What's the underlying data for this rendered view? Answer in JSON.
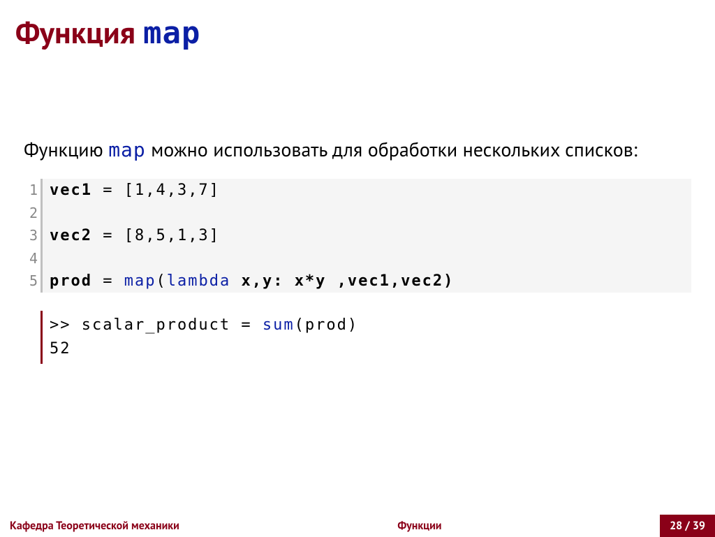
{
  "title": {
    "prefix": "Функция ",
    "code": "map"
  },
  "para": {
    "p1": "Функцию ",
    "code": "map",
    "p2": " можно использовать для обработки нескольких списков:"
  },
  "code": {
    "lines": [
      {
        "n": "1",
        "kw": "vec1",
        "rest": " = [1,4,3,7]"
      },
      {
        "n": "2",
        "kw": "",
        "rest": ""
      },
      {
        "n": "3",
        "kw": "vec2",
        "rest": " = [8,5,1,3]"
      },
      {
        "n": "4",
        "kw": "",
        "rest": ""
      },
      {
        "n": "5",
        "kw": "prod",
        "rest_pre": " = ",
        "fn": "map",
        "rest_mid": "(",
        "fn2": "lambda",
        "rest_post": " x,y: x*y ,vec1,vec2)"
      }
    ]
  },
  "output": {
    "l1_pre": ">> scalar_product = ",
    "l1_fn": "sum",
    "l1_post": "(prod)",
    "l2": "52"
  },
  "footer": {
    "left": "Кафедра Теоретической механики",
    "mid": "Функции",
    "page": "28 / 39"
  }
}
